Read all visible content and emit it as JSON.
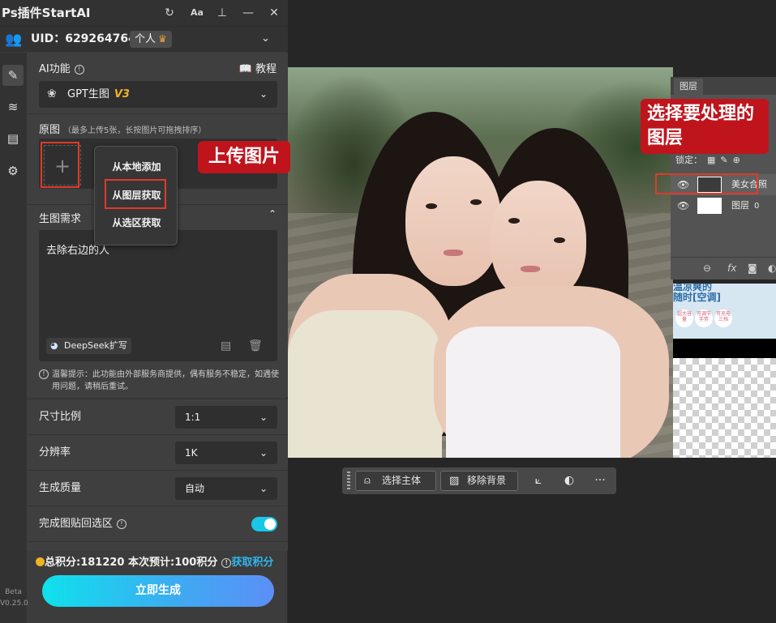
{
  "plugin": {
    "title": "Ps插件StartAI",
    "title_icons": [
      "refresh-icon",
      "font-size-icon",
      "pin-icon",
      "minimize-icon",
      "close-icon"
    ],
    "title_glyphs": {
      "refresh": "↻",
      "font": "Aa",
      "pin": "⊥",
      "minimize": "—",
      "close": "✕"
    },
    "uid_label": "UID：629264764",
    "account_badge": "个人",
    "crown_glyph": "♛",
    "sidebar_glyphs": {
      "edit": "✎",
      "layers": "≋",
      "clipboard": "▤",
      "settings": "⚙"
    },
    "beta_label": "Beta",
    "version": "V0.25.0",
    "ai_function": {
      "label": "AI功能",
      "tutorial": "教程",
      "selected": "GPT生图",
      "version_badge": "V3"
    },
    "source": {
      "label": "原图",
      "hint": "（最多上传5张，长按图片可拖拽排序）",
      "add_glyph": "+",
      "menu": [
        "从本地添加",
        "从图层获取",
        "从选区获取"
      ]
    },
    "requirement": {
      "label": "生图需求",
      "prompt": "去除右边的人",
      "deepseek_label": "DeepSeek扩写",
      "notice": "温馨提示：此功能由外部服务商提供，偶有服务不稳定，如遇使用问题，请稍后重试。"
    },
    "options": [
      {
        "label": "尺寸比例",
        "value": "1:1"
      },
      {
        "label": "分辨率",
        "value": "1K"
      },
      {
        "label": "生成质量",
        "value": "自动"
      }
    ],
    "paste_back": {
      "label": "完成图贴回选区",
      "enabled": true
    },
    "credits_text": "总积分:181220  本次预计:100积分",
    "get_credits": "获取积分",
    "generate_button": "立即生成"
  },
  "layers_panel": {
    "tab": "图层",
    "lock_label": "锁定：",
    "layers": [
      {
        "name": "美女合照",
        "visible": true,
        "selected": true
      },
      {
        "name": "图层",
        "suffix": "0",
        "visible": true,
        "selected": false
      }
    ],
    "footer_icons": [
      "link-icon",
      "fx-icon",
      "mask-icon",
      "adjustment-icon"
    ],
    "footer_glyphs": {
      "link": "⊖",
      "fx": "fx",
      "mask": "◙",
      "adjust": "◐"
    }
  },
  "context_toolbar": {
    "select_subject": "选择主体",
    "remove_background": "移除背景",
    "more": "···"
  },
  "canvas_strip": {
    "line1": "温凉爽的",
    "line2": "随时[空调]",
    "bubbles": [
      "超大容量",
      "可调节手势",
      "可充电三挡"
    ]
  },
  "callouts": {
    "upload": "上传图片",
    "layers": "选择要处理的图层"
  },
  "colors": {
    "accent_cyan": "#19c7e8",
    "link_blue": "#2fb5ee",
    "v3_gold": "#f0b429",
    "callout_red": "#c0141d"
  }
}
